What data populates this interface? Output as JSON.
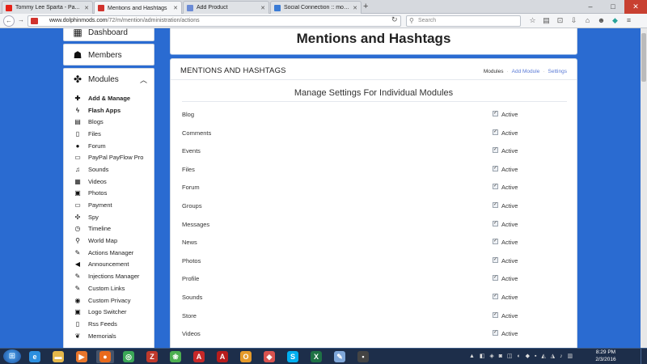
{
  "browser": {
    "tabs": [
      {
        "title": "Tommy Lee Sparta - Pa...",
        "favicon_color": "#e62117",
        "icon": "youtube-icon"
      },
      {
        "title": "Mentions and Hashtags",
        "favicon_color": "#d1332e",
        "icon": "dolphin-icon"
      },
      {
        "title": "Add Product",
        "favicon_color": "#6b8bd6",
        "icon": "infinity-icon"
      },
      {
        "title": "Social Connection :: modzzz",
        "favicon_color": "#3a7bd5",
        "icon": "globe-icon"
      }
    ],
    "url_host": "www.dolphinmods.com",
    "url_path": "/72/m/mention/administration/actions",
    "search_placeholder": "Search"
  },
  "sidebar": {
    "dashboard": "Dashboard",
    "members": "Members",
    "modules": "Modules",
    "items": [
      {
        "label": "Add & Manage",
        "icon": "plus-icon",
        "glyph": "✚",
        "bold": true
      },
      {
        "label": "Flash Apps",
        "icon": "bolt-icon",
        "glyph": "ϟ",
        "bold": true
      },
      {
        "label": "Blogs",
        "icon": "book-icon",
        "glyph": "▤",
        "bold": false
      },
      {
        "label": "Files",
        "icon": "file-icon",
        "glyph": "▯",
        "bold": false
      },
      {
        "label": "Forum",
        "icon": "chat-icon",
        "glyph": "●",
        "bold": false
      },
      {
        "label": "PayPal PayFlow Pro",
        "icon": "credit-card-icon",
        "glyph": "▭",
        "bold": false
      },
      {
        "label": "Sounds",
        "icon": "music-icon",
        "glyph": "♫",
        "bold": false
      },
      {
        "label": "Videos",
        "icon": "film-icon",
        "glyph": "▦",
        "bold": false
      },
      {
        "label": "Photos",
        "icon": "picture-icon",
        "glyph": "▣",
        "bold": false
      },
      {
        "label": "Payment",
        "icon": "credit-card-icon",
        "glyph": "▭",
        "bold": false
      },
      {
        "label": "Spy",
        "icon": "crosshair-icon",
        "glyph": "✣",
        "bold": false
      },
      {
        "label": "Timeline",
        "icon": "clock-icon",
        "glyph": "◷",
        "bold": false
      },
      {
        "label": "World Map",
        "icon": "map-marker-icon",
        "glyph": "⚲",
        "bold": false
      },
      {
        "label": "Actions Manager",
        "icon": "wrench-icon",
        "glyph": "✎",
        "bold": false
      },
      {
        "label": "Announcement",
        "icon": "bullhorn-icon",
        "glyph": "◀",
        "bold": false
      },
      {
        "label": "Injections Manager",
        "icon": "wrench-icon",
        "glyph": "✎",
        "bold": false
      },
      {
        "label": "Custom Links",
        "icon": "wrench-icon",
        "glyph": "✎",
        "bold": false
      },
      {
        "label": "Custom Privacy",
        "icon": "eye-icon",
        "glyph": "◉",
        "bold": false
      },
      {
        "label": "Logo Switcher",
        "icon": "picture-icon",
        "glyph": "▣",
        "bold": false
      },
      {
        "label": "Rss Feeds",
        "icon": "file-icon",
        "glyph": "▯",
        "bold": false
      },
      {
        "label": "Memorials",
        "icon": "leaf-icon",
        "glyph": "❦",
        "bold": false
      }
    ]
  },
  "main": {
    "page_title": "Mentions and Hashtags",
    "card_title": "MENTIONS AND HASHTAGS",
    "menu": {
      "modules": "Modules",
      "add_module": "Add Module",
      "settings": "Settings"
    },
    "section_title": "Manage Settings For Individual Modules",
    "active_label": "Active",
    "rows": [
      {
        "label": "Blog",
        "checked": true
      },
      {
        "label": "Comments",
        "checked": true
      },
      {
        "label": "Events",
        "checked": true
      },
      {
        "label": "Files",
        "checked": true
      },
      {
        "label": "Forum",
        "checked": true
      },
      {
        "label": "Groups",
        "checked": true
      },
      {
        "label": "Messages",
        "checked": true
      },
      {
        "label": "News",
        "checked": true
      },
      {
        "label": "Photos",
        "checked": true
      },
      {
        "label": "Profile",
        "checked": true
      },
      {
        "label": "Sounds",
        "checked": true
      },
      {
        "label": "Store",
        "checked": true
      },
      {
        "label": "Videos",
        "checked": true
      }
    ]
  },
  "taskbar": {
    "time": "8:29 PM",
    "date": "2/3/2016",
    "apps": [
      {
        "icon": "internet-explorer-icon",
        "glyph": "e",
        "color": "#2c8fe0",
        "active": false
      },
      {
        "icon": "folder-icon",
        "glyph": "▬",
        "color": "#e5b84a",
        "active": false
      },
      {
        "icon": "media-player-icon",
        "glyph": "▶",
        "color": "#e8762b",
        "active": false
      },
      {
        "icon": "firefox-icon",
        "glyph": "●",
        "color": "#e86a1c",
        "active": true
      },
      {
        "icon": "chrome-icon",
        "glyph": "◎",
        "color": "#3aa757",
        "active": false
      },
      {
        "icon": "filezilla-icon",
        "glyph": "Z",
        "color": "#c0392b",
        "active": false
      },
      {
        "icon": "frog-icon",
        "glyph": "❀",
        "color": "#4caf50",
        "active": false
      },
      {
        "icon": "acrobat-icon",
        "glyph": "A",
        "color": "#c62828",
        "active": false
      },
      {
        "icon": "acrobat-pro-icon",
        "glyph": "A",
        "color": "#b71c1c",
        "active": false
      },
      {
        "icon": "outlook-icon",
        "glyph": "O",
        "color": "#e59a2a",
        "active": false
      },
      {
        "icon": "paint-icon",
        "glyph": "◆",
        "color": "#d9534f",
        "active": false
      },
      {
        "icon": "skype-icon",
        "glyph": "S",
        "color": "#00aff0",
        "active": false
      },
      {
        "icon": "excel-icon",
        "glyph": "X",
        "color": "#1e7145",
        "active": false
      },
      {
        "icon": "tools-icon",
        "glyph": "✎",
        "color": "#7fa7d9",
        "active": false
      },
      {
        "icon": "terminal-icon",
        "glyph": "▪",
        "color": "#444",
        "active": false
      }
    ]
  }
}
